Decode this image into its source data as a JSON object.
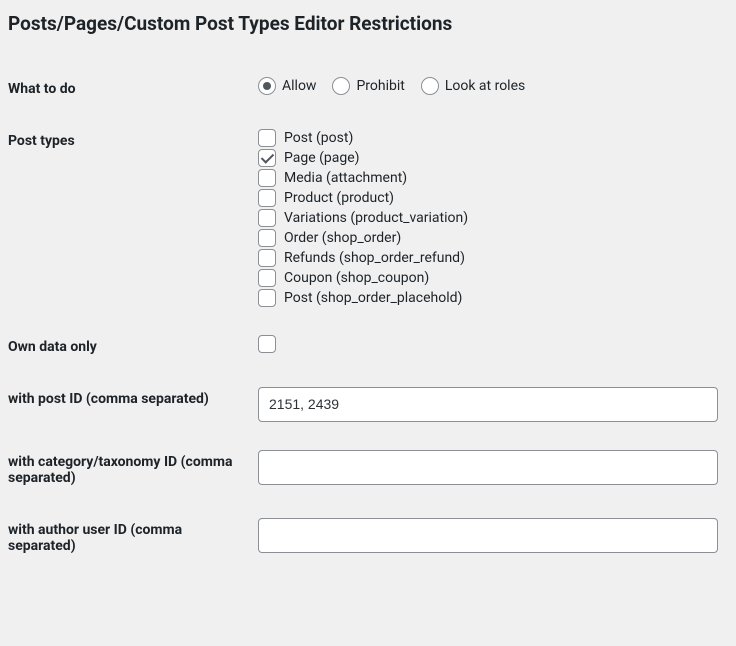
{
  "section_title": "Posts/Pages/Custom Post Types Editor Restrictions",
  "rows": {
    "what_to_do": {
      "label": "What to do",
      "options": [
        {
          "label": "Allow",
          "value": "allow"
        },
        {
          "label": "Prohibit",
          "value": "prohibit"
        },
        {
          "label": "Look at roles",
          "value": "look_at_roles"
        }
      ],
      "selected": "allow"
    },
    "post_types": {
      "label": "Post types",
      "options": [
        {
          "label": "Post (post)",
          "checked": false
        },
        {
          "label": "Page (page)",
          "checked": true
        },
        {
          "label": "Media (attachment)",
          "checked": false
        },
        {
          "label": "Product (product)",
          "checked": false
        },
        {
          "label": "Variations (product_variation)",
          "checked": false
        },
        {
          "label": "Order (shop_order)",
          "checked": false
        },
        {
          "label": "Refunds (shop_order_refund)",
          "checked": false
        },
        {
          "label": "Coupon (shop_coupon)",
          "checked": false
        },
        {
          "label": "Post (shop_order_placehold)",
          "checked": false
        }
      ]
    },
    "own_data_only": {
      "label": "Own data only",
      "checked": false
    },
    "post_id": {
      "label": "with post ID (comma separated)",
      "value": "2151, 2439"
    },
    "category_id": {
      "label": "with category/taxonomy ID (comma separated)",
      "value": ""
    },
    "author_id": {
      "label": "with author user ID (comma separated)",
      "value": ""
    }
  }
}
